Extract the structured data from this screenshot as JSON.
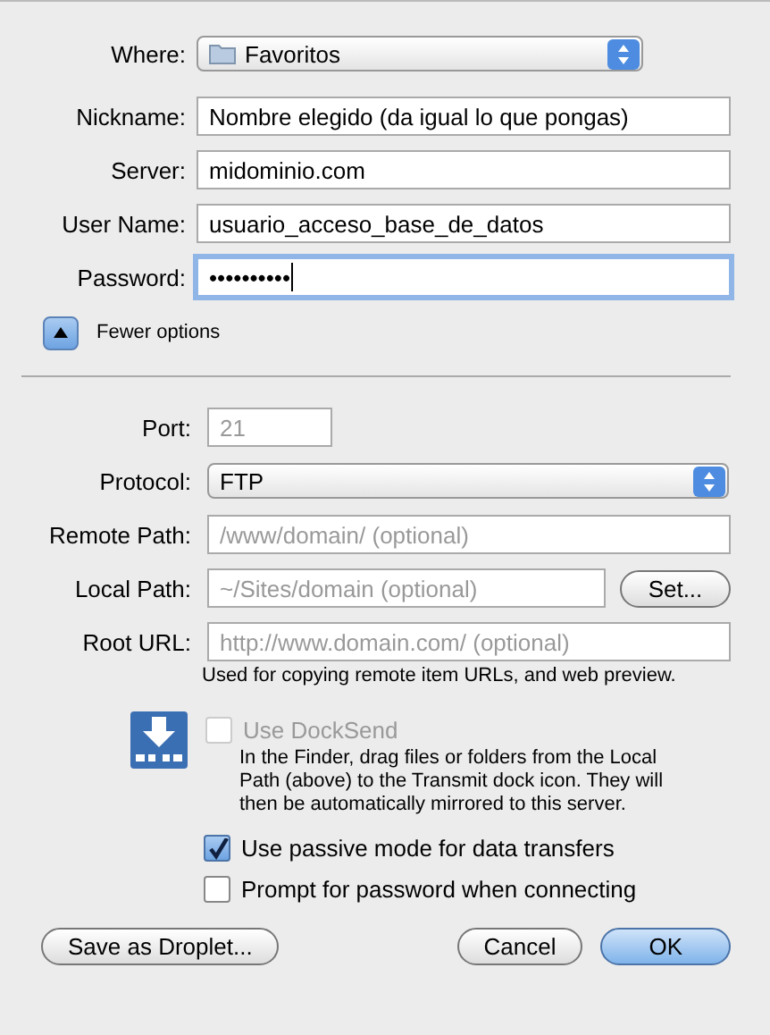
{
  "where": {
    "label": "Where:",
    "value": "Favoritos"
  },
  "fields": [
    {
      "label": "Nickname:",
      "value": "Nombre elegido (da igual lo que pongas)",
      "focused": false
    },
    {
      "label": "Server:",
      "value": "midominio.com",
      "focused": false
    },
    {
      "label": "User Name:",
      "value": "usuario_acceso_base_de_datos",
      "focused": false
    },
    {
      "label": "Password:",
      "value": "••••••••••",
      "focused": true
    }
  ],
  "disclosure": {
    "label": "Fewer options",
    "expanded": true
  },
  "port": {
    "label": "Port:",
    "placeholder": "21"
  },
  "protocol": {
    "label": "Protocol:",
    "value": "FTP"
  },
  "remote_path": {
    "label": "Remote Path:",
    "placeholder": "/www/domain/ (optional)"
  },
  "local_path": {
    "label": "Local Path:",
    "placeholder": "~/Sites/domain (optional)",
    "button": "Set..."
  },
  "root_url": {
    "label": "Root URL:",
    "placeholder": "http://www.domain.com/ (optional)",
    "note": "Used for copying remote item URLs, and web preview."
  },
  "docksend": {
    "label": "Use DockSend",
    "checked": false,
    "disabled": true,
    "description": "In the Finder, drag files or folders from the Local Path (above) to the Transmit dock icon. They will then be automatically mirrored to this server."
  },
  "options": [
    {
      "label": "Use passive mode for data transfers",
      "checked": true
    },
    {
      "label": "Prompt for password when connecting",
      "checked": false
    }
  ],
  "buttons": [
    {
      "label": "Save as Droplet...",
      "default": false
    },
    {
      "label": "Cancel",
      "default": false
    },
    {
      "label": "OK",
      "default": true
    }
  ]
}
